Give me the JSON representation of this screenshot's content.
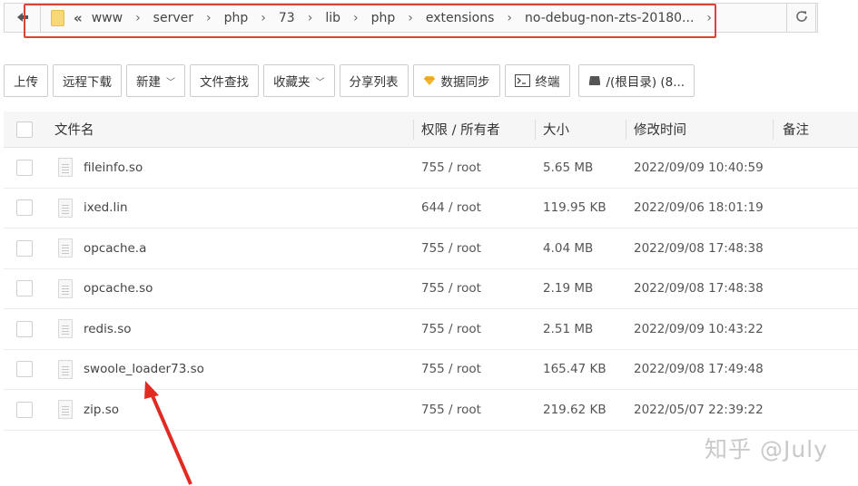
{
  "path_bar": {
    "back_icon": "back-arrow-icon",
    "folder_icon": "folder-icon",
    "collapse_icon": "double-chevron-left-icon",
    "segments": [
      "www",
      "server",
      "php",
      "73",
      "lib",
      "php",
      "extensions",
      "no-debug-non-zts-20180..."
    ],
    "highlight_color": "#d94437",
    "refresh_icon": "refresh-icon"
  },
  "toolbar": {
    "upload": "上传",
    "remote_download": "远程下载",
    "new": "新建",
    "file_search": "文件查找",
    "favorites": "收藏夹",
    "share_list": "分享列表",
    "data_sync": "数据同步",
    "terminal": "终端",
    "root_dir": "/(根目录) (8..."
  },
  "table": {
    "columns": {
      "name": "文件名",
      "perm": "权限 / 所有者",
      "size": "大小",
      "mtime": "修改时间",
      "note": "备注"
    },
    "rows": [
      {
        "name": "fileinfo.so",
        "perm": "755 / root",
        "size": "5.65 MB",
        "mtime": "2022/09/09 10:40:59"
      },
      {
        "name": "ixed.lin",
        "perm": "644 / root",
        "size": "119.95 KB",
        "mtime": "2022/09/06 18:01:19"
      },
      {
        "name": "opcache.a",
        "perm": "755 / root",
        "size": "4.04 MB",
        "mtime": "2022/09/08 17:48:38"
      },
      {
        "name": "opcache.so",
        "perm": "755 / root",
        "size": "2.19 MB",
        "mtime": "2022/09/08 17:48:38"
      },
      {
        "name": "redis.so",
        "perm": "755 / root",
        "size": "2.51 MB",
        "mtime": "2022/09/09 10:43:22"
      },
      {
        "name": "swoole_loader73.so",
        "perm": "755 / root",
        "size": "165.47 KB",
        "mtime": "2022/09/08 17:49:48"
      },
      {
        "name": "zip.so",
        "perm": "755 / root",
        "size": "219.62 KB",
        "mtime": "2022/05/07 22:39:22"
      }
    ]
  },
  "annotation": {
    "arrow_color": "#e02a22"
  },
  "watermark": "知乎 @July"
}
